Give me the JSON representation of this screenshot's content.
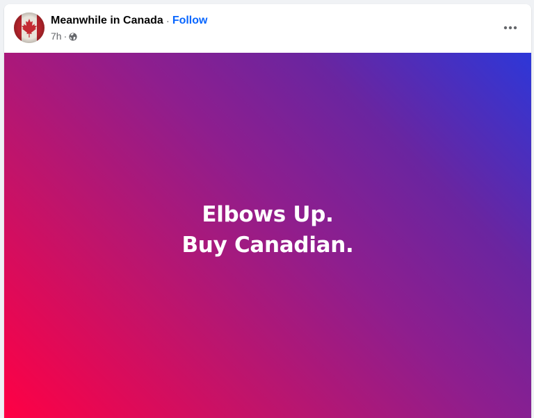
{
  "post": {
    "page_name": "Meanwhile in Canada",
    "separator": "·",
    "follow_label": "Follow",
    "timestamp": "7h",
    "time_separator": "·",
    "audience_icon": "globe-icon",
    "more_icon": "more-options-icon",
    "avatar_icon": "canada-flag-avatar"
  },
  "media": {
    "line1": "Elbows Up.",
    "line2": "Buy Canadian.",
    "text_color": "#ffffff",
    "gradient": [
      "#ff0044",
      "#8e1e8e",
      "#2d37d8"
    ]
  },
  "colors": {
    "link": "#0866ff",
    "secondary_text": "#65676b",
    "primary_text": "#050505"
  }
}
